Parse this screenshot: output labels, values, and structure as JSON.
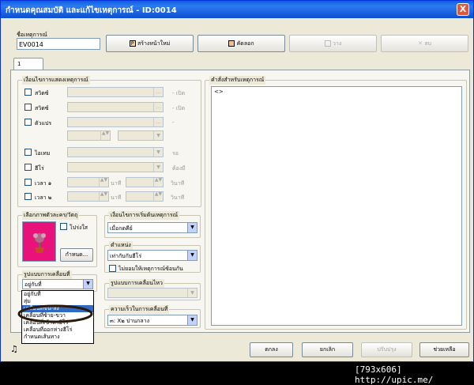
{
  "window": {
    "title": "กำหนดคุณสมบัติ และแก้ไขเหตุการณ์ - ID:0014",
    "close": "X"
  },
  "event_name": {
    "label": "ชื่อเหตุการณ์",
    "value": "EV0014"
  },
  "toolbar": {
    "new": "สร้างหน้าใหม่",
    "copy": "คัดลอก",
    "paste": "วาง",
    "delete": "ลบ"
  },
  "tab": {
    "label": "1"
  },
  "conditions": {
    "title": "เงื่อนไขการแสดงเหตุการณ์",
    "switch1": "สวิตซ์",
    "switch1_suffix": "- เปิด",
    "switch2": "สวิตซ์",
    "switch2_suffix": "- เปิด",
    "variable": "ตัวแปร",
    "variable_suffix": "-",
    "item": "ไอเทม",
    "item_suffix": "รอ",
    "hero": "ฮีโร่",
    "hero_suffix": "ต้องมี",
    "timer1": "เวลา ๑",
    "timer2": "เวลา ๒",
    "minutes": "นาที",
    "seconds": "วินาที"
  },
  "commands": {
    "title": "คำสั่งสำหรับเหตุการณ์",
    "first": "<>"
  },
  "graphic": {
    "title": "เลือกภาพตัวละคร/วัตถุ",
    "transparent": "โปร่งใส",
    "set_button": "กำหนด..."
  },
  "trigger": {
    "title": "เงื่อนไขการเริ่มต้นเหตุการณ์",
    "value": "เมื่อกดคีย์"
  },
  "position": {
    "title": "ตำแหน่ง",
    "value": "เท่ากับกับฮีโร่",
    "no_overlap": "ไม่ยอมให้เหตุการณ์ซ้อนกัน"
  },
  "movement": {
    "title": "รูปแบบการเคลื่อนที่",
    "value": "อยู่กับที่",
    "options": [
      "อยู่กับที่",
      "สุ่ม",
      "เคลื่อนที่ขึ้น-ลง",
      "เคลื่อนที่ซ้าย-ขวา",
      "เคลื่อนที่เข้าหาฮีโร่",
      "เคลื่อนที่ออกห่างฮีโร่",
      "กำหนดเส้นทาง"
    ],
    "selected_index": 2
  },
  "animation": {
    "title": "รูปแบบการเคลื่อนไหว"
  },
  "speed": {
    "title": "ความเร็วในการเคลื่อนที่",
    "value": "๓: X๒ ปานกลาง"
  },
  "footer": {
    "ok": "ตกลง",
    "cancel": "ยกเลิก",
    "apply": "ปรับปรุง",
    "help": "ช่วยเหลือ",
    "music_icon": "♫"
  },
  "watermark": "[793x606] http://upic.me/"
}
